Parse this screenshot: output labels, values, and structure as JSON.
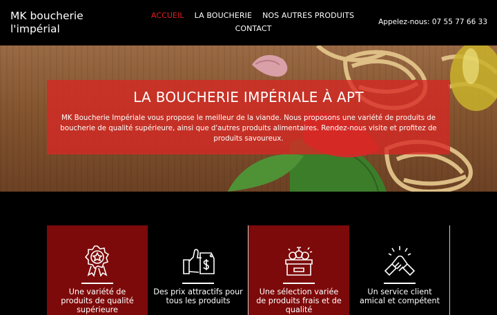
{
  "header": {
    "brand": "MK boucherie l'impérial",
    "nav": [
      {
        "label": "ACCUEIL",
        "active": true
      },
      {
        "label": "LA BOUCHERIE",
        "active": false
      },
      {
        "label": "NOS AUTRES PRODUITS",
        "active": false
      },
      {
        "label": "CONTACT",
        "active": false
      }
    ],
    "phone": "Appelez-nous: 07 55 77 66 33"
  },
  "hero": {
    "title": "LA BOUCHERIE IMPÉRIALE À APT",
    "text": "MK Boucherie Impériale vous propose le meilleur de la viande. Nous proposons une variété de produits de boucherie de qualité supérieure, ainsi que d'autres produits alimentaires. Rendez-nous visite et profitez de produits savoureux."
  },
  "features": [
    {
      "icon": "award-ribbon-icon",
      "text": "Une variété de produits de qualité supérieure"
    },
    {
      "icon": "price-tag-thumbs-up-icon",
      "text": "Des prix attractifs pour tous les produits"
    },
    {
      "icon": "food-crate-icon",
      "text": "Une sélection variée de produits frais et de qualité"
    },
    {
      "icon": "handshake-icon",
      "text": "Un service client amical et compétent"
    }
  ],
  "colors": {
    "accent_red": "#e02020",
    "hero_box": "#d82824",
    "card_red": "#7d0a0a"
  }
}
